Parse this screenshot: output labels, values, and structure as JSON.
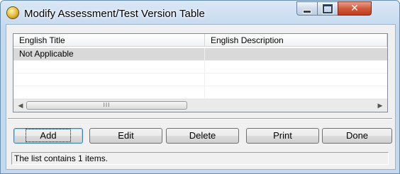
{
  "window": {
    "title": "Modify Assessment/Test Version Table",
    "controls": {
      "minimize": "minimize",
      "maximize": "maximize",
      "close": "✕"
    }
  },
  "list": {
    "columns": [
      "English Title",
      "English Description"
    ],
    "rows": [
      {
        "title": "Not Applicable",
        "description": ""
      }
    ],
    "scrollbar_grip": "III"
  },
  "buttons": {
    "add": "Add",
    "edit": "Edit",
    "delete": "Delete",
    "print": "Print",
    "done": "Done"
  },
  "status_text": "The list contains 1 items.",
  "icons": {
    "app": "app-globe-icon",
    "scroll_left": "scroll-left-arrow-icon",
    "scroll_right": "scroll-right-arrow-icon"
  },
  "colors": {
    "title_bar": "#c4d8ee",
    "close_button": "#c23a1c",
    "selected_row": "#d9d9d9",
    "default_button_border": "#3c7fb1"
  }
}
